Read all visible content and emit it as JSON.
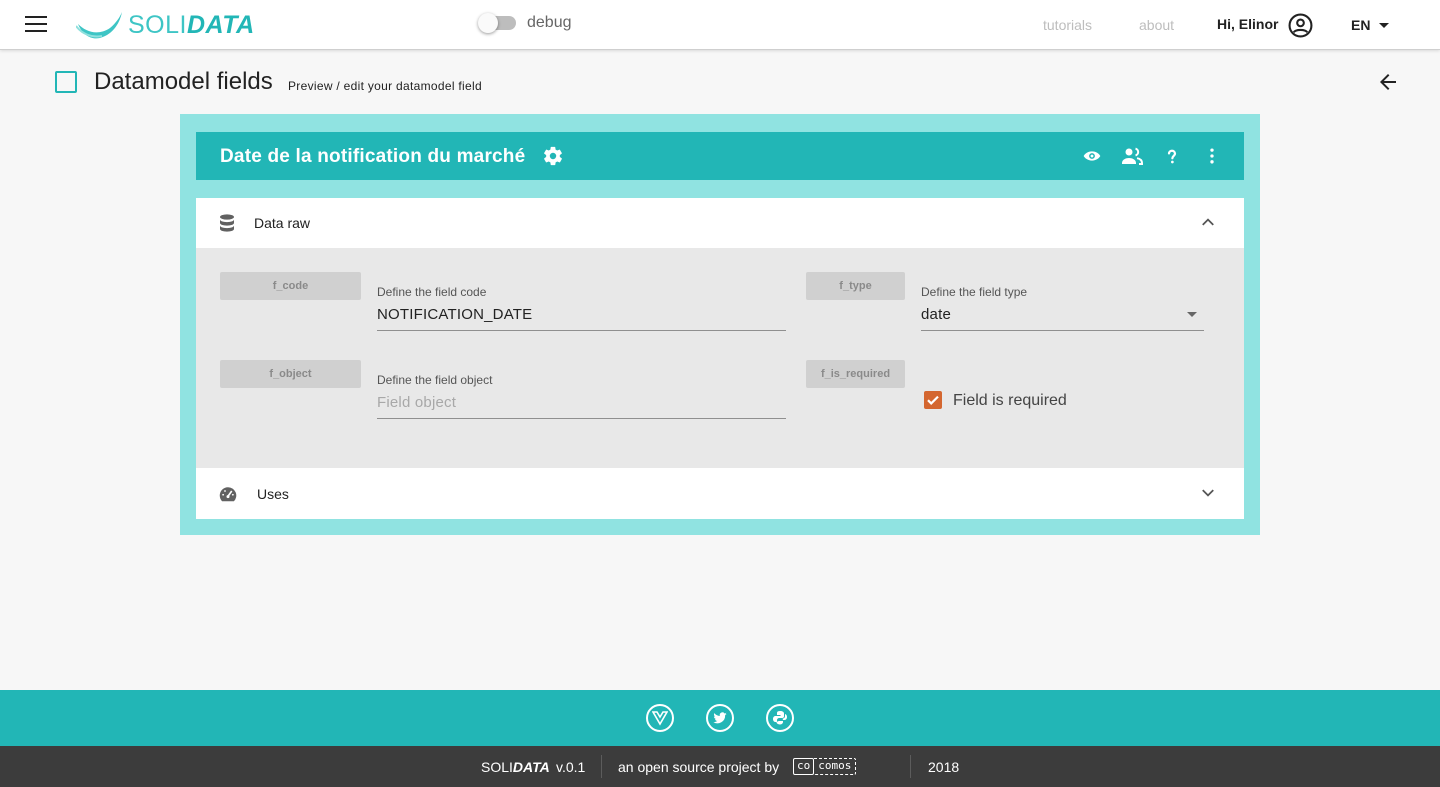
{
  "app": {
    "logo_soli": "SOLI",
    "logo_data": "DATA",
    "brand_color": "#22b6b6"
  },
  "topbar": {
    "menu_icon": "menu-icon",
    "debug_label": "debug",
    "debug_enabled": false,
    "links": [
      "tutorials",
      "about"
    ],
    "greeting": "Hi, Elinor",
    "account_icon": "account-circle-icon",
    "language": "EN"
  },
  "page": {
    "title": "Datamodel fields",
    "subtitle": "Preview / edit your datamodel field",
    "back_icon": "arrow-left-icon"
  },
  "card": {
    "title": "Date de la notification du marché",
    "header_icons": [
      "settings-icon",
      "eye-icon",
      "people-icon",
      "help-icon",
      "more-vert-icon"
    ]
  },
  "panels": {
    "data_raw": {
      "label": "Data raw",
      "icon": "database-icon",
      "expanded": true,
      "fields": {
        "code": {
          "chip": "f_code",
          "label": "Define the field code",
          "value": "NOTIFICATION_DATE"
        },
        "type": {
          "chip": "f_type",
          "label": "Define the field type",
          "value": "date"
        },
        "object": {
          "chip": "f_object",
          "label": "Define the field object",
          "value": "",
          "placeholder": "Field object"
        },
        "is_required": {
          "chip": "f_is_required",
          "checkbox_label": "Field is required",
          "checked": true
        }
      }
    },
    "uses": {
      "label": "Uses",
      "icon": "speedometer-icon",
      "expanded": false
    }
  },
  "footer": {
    "social_icons": [
      "vue-icon",
      "twitter-icon",
      "python-icon"
    ],
    "brand_soli": "SOLI",
    "brand_data": "DATA",
    "version": "v.0.1",
    "tagline": "an open source project by",
    "org_part1": "co",
    "org_part2": "comos",
    "year": "2018"
  }
}
